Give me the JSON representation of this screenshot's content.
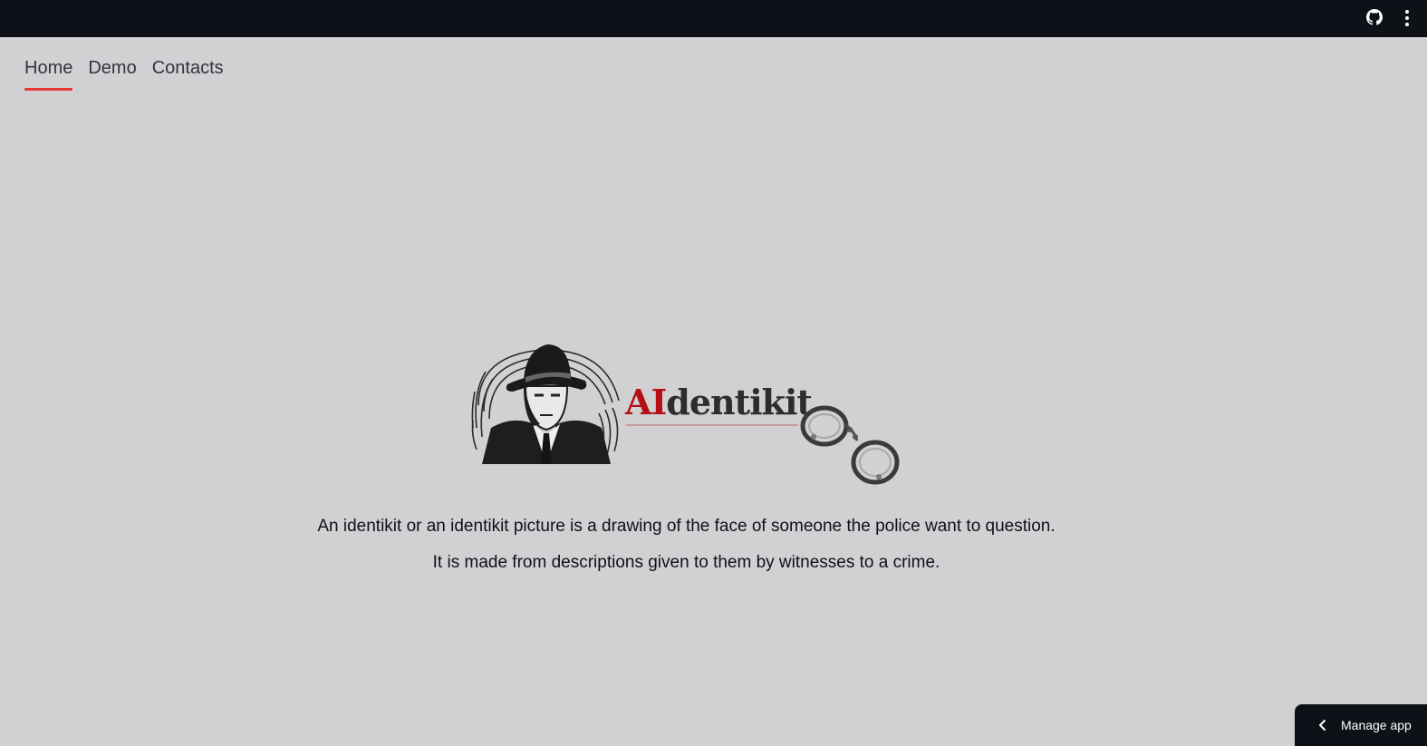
{
  "topbar": {
    "github_icon": "github-icon",
    "menu_icon": "kebab-menu-icon"
  },
  "tabs": [
    {
      "label": "Home",
      "active": true
    },
    {
      "label": "Demo",
      "active": false
    },
    {
      "label": "Contacts",
      "active": false
    }
  ],
  "logo": {
    "text_ai": "AI",
    "text_rest": "dentikit",
    "detective_icon": "detective-icon",
    "handcuffs_icon": "handcuffs-icon"
  },
  "description": {
    "line1": "An identikit or an identikit picture is a drawing of the face of someone the police want to question.",
    "line2": "It is made from descriptions given to them by witnesses to a crime."
  },
  "manage_app": {
    "label": "Manage app",
    "icon": "chevron-left-icon"
  },
  "colors": {
    "background": "#d1d1d3",
    "topbar": "#0e1117",
    "accent": "#e53935",
    "logo_red": "#b40f14"
  }
}
